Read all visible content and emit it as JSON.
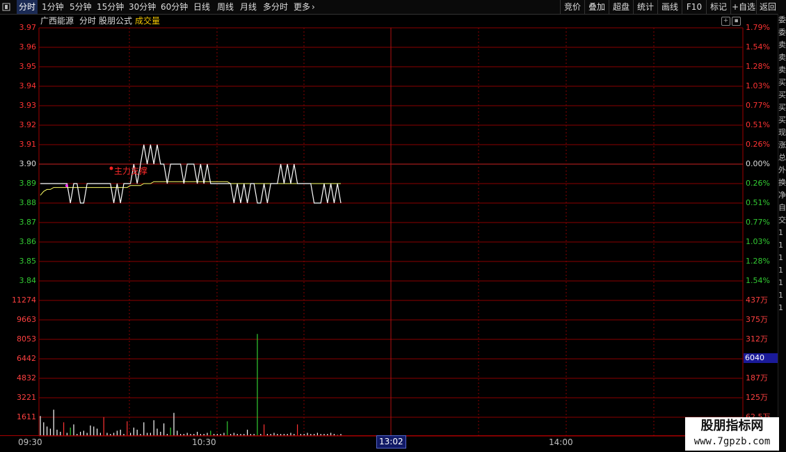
{
  "colors": {
    "up": "#ff3333",
    "down": "#33cc33",
    "grid": "#8b0000",
    "price_line": "#ffffff",
    "avg_line": "#ffff66",
    "accent": "#f0c400"
  },
  "topbar": {
    "menu_icon": "menu-square-icon",
    "tabs": [
      "分时",
      "1分钟",
      "5分钟",
      "15分钟",
      "30分钟",
      "60分钟",
      "日线",
      "周线",
      "月线",
      "多分时",
      "更多"
    ],
    "active_tab": "分时",
    "more_icon": "chevron-right-icon",
    "right_buttons": [
      "竞价",
      "叠加",
      "超盘",
      "统计",
      "画线",
      "F10",
      "标记",
      "+自选",
      "返回"
    ]
  },
  "chart_header": {
    "stock_name": "广西能源",
    "mode": "分时",
    "formula": "股朋公式",
    "volume_label": "成交量"
  },
  "annotation": {
    "label": "主力支撑"
  },
  "price_axis": {
    "left_labels": [
      "3.97",
      "3.96",
      "3.95",
      "3.94",
      "3.93",
      "3.92",
      "3.91",
      "3.90",
      "3.89",
      "3.88",
      "3.87",
      "3.86",
      "3.85",
      "3.84"
    ],
    "right_labels": [
      "1.79%",
      "1.54%",
      "1.28%",
      "1.03%",
      "0.77%",
      "0.51%",
      "0.26%",
      "0.00%",
      "0.26%",
      "0.51%",
      "0.77%",
      "1.03%",
      "1.28%",
      "1.54%"
    ]
  },
  "volume_axis": {
    "left_labels": [
      "11274",
      "9663",
      "8053",
      "6442",
      "4832",
      "3221",
      "1611"
    ],
    "right_labels": [
      "437万",
      "375万",
      "312万",
      "250万",
      "187万",
      "125万",
      "62.5万"
    ]
  },
  "time_axis": {
    "labels": [
      "09:30",
      "10:30",
      "14:00"
    ],
    "cursor_time": "13:02"
  },
  "cursor_value": "6040",
  "watermark": {
    "title": "股朋指标网",
    "url": "www.7gpzb.com"
  },
  "right_side_chars": [
    "委",
    "委",
    "卖",
    "卖",
    "卖",
    "买",
    "买",
    "买",
    "买",
    "现",
    "涨",
    "总",
    "外",
    "换",
    "净",
    "自",
    "交",
    "1",
    "1",
    "1",
    "1",
    "1",
    "1",
    "1"
  ],
  "chart_data": {
    "type": "line",
    "price": {
      "prev_close": 3.9,
      "ylim": [
        3.835,
        3.975
      ],
      "values": [
        3.89,
        3.89,
        3.89,
        3.89,
        3.89,
        3.89,
        3.89,
        3.89,
        3.89,
        3.88,
        3.89,
        3.89,
        3.88,
        3.88,
        3.89,
        3.89,
        3.89,
        3.89,
        3.89,
        3.89,
        3.89,
        3.89,
        3.88,
        3.89,
        3.88,
        3.89,
        3.89,
        3.89,
        3.9,
        3.89,
        3.9,
        3.91,
        3.9,
        3.91,
        3.9,
        3.91,
        3.9,
        3.9,
        3.89,
        3.9,
        3.9,
        3.9,
        3.9,
        3.89,
        3.9,
        3.9,
        3.9,
        3.89,
        3.9,
        3.89,
        3.9,
        3.89,
        3.89,
        3.89,
        3.89,
        3.89,
        3.89,
        3.89,
        3.88,
        3.89,
        3.88,
        3.89,
        3.88,
        3.89,
        3.89,
        3.88,
        3.88,
        3.89,
        3.88,
        3.89,
        3.89,
        3.89,
        3.9,
        3.89,
        3.9,
        3.89,
        3.9,
        3.89,
        3.89,
        3.89,
        3.89,
        3.89,
        3.88,
        3.88,
        3.88,
        3.89,
        3.88,
        3.89,
        3.88,
        3.89,
        3.88
      ],
      "avg_values": [
        3.884,
        3.886,
        3.887,
        3.887,
        3.888,
        3.888,
        3.888,
        3.888,
        3.888,
        3.888,
        3.888,
        3.888,
        3.888,
        3.888,
        3.888,
        3.888,
        3.888,
        3.888,
        3.888,
        3.888,
        3.888,
        3.888,
        3.888,
        3.888,
        3.888,
        3.888,
        3.888,
        3.889,
        3.889,
        3.889,
        3.889,
        3.89,
        3.89,
        3.89,
        3.891,
        3.891,
        3.891,
        3.891,
        3.891,
        3.891,
        3.891,
        3.891,
        3.891,
        3.891,
        3.891,
        3.891,
        3.891,
        3.891,
        3.891,
        3.891,
        3.891,
        3.891,
        3.891,
        3.891,
        3.891,
        3.891,
        3.891,
        3.89,
        3.89,
        3.89,
        3.89,
        3.89,
        3.89,
        3.89,
        3.89,
        3.89,
        3.89,
        3.89,
        3.89,
        3.89,
        3.89,
        3.89,
        3.89,
        3.89,
        3.89,
        3.89,
        3.89,
        3.89,
        3.89,
        3.89,
        3.89,
        3.89,
        3.89,
        3.89,
        3.89,
        3.89,
        3.89,
        3.89,
        3.89,
        3.89,
        3.89
      ]
    },
    "volume": {
      "ylim": [
        0,
        12885
      ],
      "values": [
        1900,
        1300,
        900,
        700,
        2500,
        600,
        400,
        1300,
        300,
        800,
        1100,
        200,
        400,
        500,
        300,
        1000,
        900,
        700,
        300,
        1800,
        300,
        200,
        300,
        500,
        600,
        200,
        1400,
        300,
        800,
        600,
        200,
        1300,
        300,
        300,
        1500,
        700,
        400,
        1200,
        200,
        800,
        2200,
        500,
        200,
        200,
        300,
        200,
        200,
        400,
        200,
        200,
        300,
        500,
        200,
        200,
        200,
        300,
        1400,
        200,
        300,
        200,
        200,
        200,
        600,
        200,
        200,
        9700,
        200,
        1100,
        200,
        200,
        300,
        200,
        200,
        200,
        200,
        300,
        200,
        1100,
        200,
        200,
        300,
        200,
        200,
        300,
        200,
        200,
        200,
        300,
        200,
        100,
        200
      ],
      "colors": [
        "w",
        "w",
        "w",
        "w",
        "w",
        "w",
        "w",
        "r",
        "w",
        "g",
        "w",
        "w",
        "w",
        "w",
        "w",
        "w",
        "w",
        "w",
        "w",
        "r",
        "w",
        "w",
        "w",
        "w",
        "w",
        "w",
        "r",
        "w",
        "w",
        "w",
        "w",
        "w",
        "w",
        "w",
        "w",
        "w",
        "w",
        "w",
        "w",
        "g",
        "w",
        "w",
        "w",
        "w",
        "w",
        "w",
        "w",
        "w",
        "w",
        "w",
        "w",
        "g",
        "w",
        "w",
        "w",
        "w",
        "g",
        "w",
        "w",
        "w",
        "w",
        "w",
        "w",
        "w",
        "w",
        "g",
        "w",
        "r",
        "w",
        "w",
        "w",
        "w",
        "w",
        "w",
        "w",
        "w",
        "w",
        "r",
        "w",
        "w",
        "w",
        "w",
        "w",
        "w",
        "w",
        "w",
        "w",
        "w",
        "w",
        "w",
        "w"
      ]
    }
  }
}
